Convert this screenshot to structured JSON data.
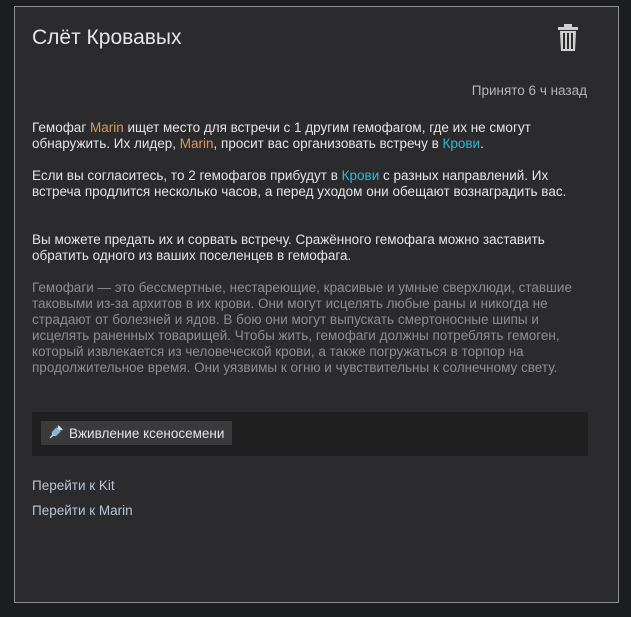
{
  "quest": {
    "title": "Слёт Кровавых",
    "accepted": "Принято 6 ч назад",
    "p1": {
      "a": "Гемофаг ",
      "pawn1": "Marin",
      "b": " ищет место для встречи с 1 другим гемофагом, где их не смогут обнаружить. Их лидер, ",
      "pawn2": "Marin",
      "c": ", просит вас организовать встречу в ",
      "place": "Крови",
      "d": "."
    },
    "p2": {
      "a": "Если вы согласитесь, то 2 гемофагов прибудут в ",
      "place": "Крови",
      "b": " с разных направлений. Их встреча продлится несколько часов, а перед уходом они обещают вознаградить вас."
    },
    "p3": "Вы можете предать их и сорвать встречу. Сражённого гемофага можно заставить обратить одного из ваших поселенцев в гемофага.",
    "p4": "Гемофаги — это бессмертные, нестареющие, красивые и умные сверхлюди, ставшие таковыми из-за архитов в их крови. Они могут исцелять любые раны и никогда не страдают от болезней и ядов. В бою они могут выпускать смертоносные шипы и исцелять раненных товарищей. Чтобы жить, гемофаги должны потреблять гемоген, который извлекается из человеческой крови, а также погружаться в торпор на продолжительное время. Они уязвимы к огню и чувствительны к солнечному свету.",
    "reward": {
      "label": "Вживление ксеносемени",
      "icon": "syringe-icon"
    },
    "links": [
      "Перейти к Kit",
      "Перейти к Marin"
    ]
  },
  "colors": {
    "pawn": "#d79a5c",
    "place": "#2fb7d4",
    "link": "#b8c4d6"
  }
}
